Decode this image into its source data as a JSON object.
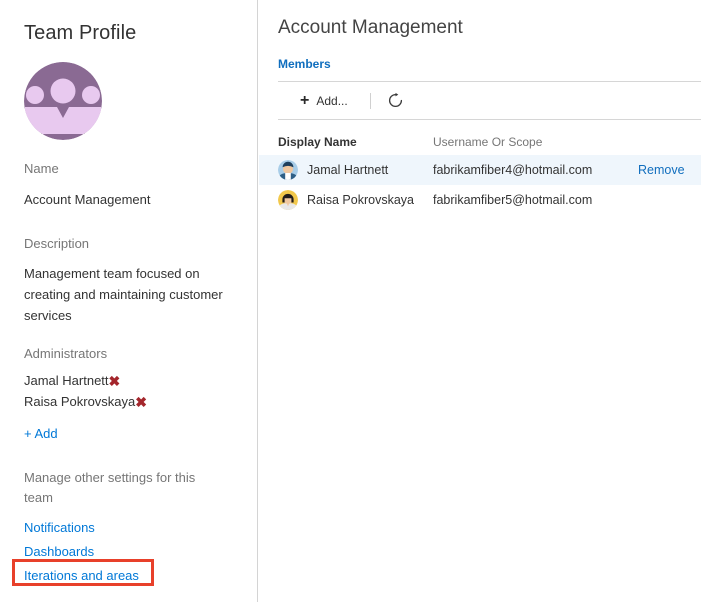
{
  "left_panel": {
    "title": "Team Profile",
    "avatar_icon": "team-group-icon",
    "avatar_bg_color": "#8a6a93",
    "avatar_fg_color": "#e8c9ef",
    "name_label": "Name",
    "name_value": "Account Management",
    "description_label": "Description",
    "description_value": "Management team focused on creating and maintaining customer services",
    "administrators_label": "Administrators",
    "administrators": [
      {
        "name": "Jamal Hartnett",
        "remove_icon": "remove-x-icon"
      },
      {
        "name": "Raisa Pokrovskaya",
        "remove_icon": "remove-x-icon"
      }
    ],
    "add_admin_label": "+ Add",
    "manage_text": "Manage other settings for this team",
    "settings_links": [
      {
        "label": "Notifications",
        "highlighted": false
      },
      {
        "label": "Dashboards",
        "highlighted": false
      },
      {
        "label": "Iterations and areas",
        "highlighted": true
      }
    ],
    "highlight_color": "#e8402a",
    "link_color": "#0078d7",
    "label_color": "#767676",
    "remove_x_color": "#a4262c"
  },
  "right_panel": {
    "section_title": "Account Management",
    "tab_label": "Members",
    "tab_color": "#106ebe",
    "toolbar": {
      "add_icon": "plus-icon",
      "add_label": "Add...",
      "refresh_icon": "refresh-icon"
    },
    "table": {
      "columns": [
        "Display Name",
        "Username Or Scope",
        ""
      ],
      "rows": [
        {
          "avatar": "user-avatar-male",
          "display_name": "Jamal Hartnett",
          "username": "fabrikamfiber4@hotmail.com",
          "action": "Remove",
          "selected": true
        },
        {
          "avatar": "user-avatar-female",
          "display_name": "Raisa Pokrovskaya",
          "username": "fabrikamfiber5@hotmail.com",
          "action": "",
          "selected": false
        }
      ],
      "selected_row_bg": "#eff6fc"
    }
  }
}
